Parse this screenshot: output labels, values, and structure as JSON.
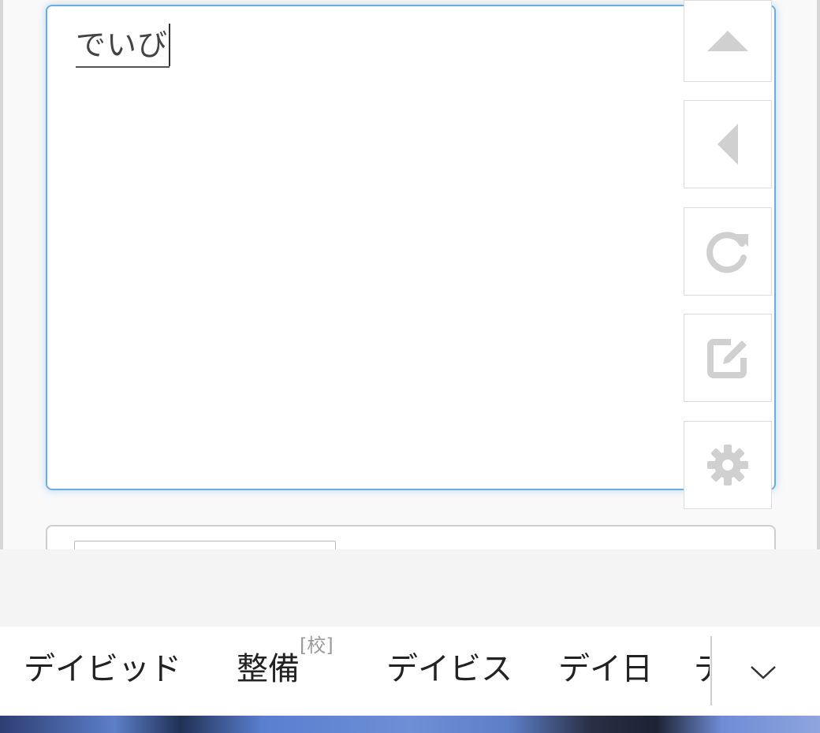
{
  "editor": {
    "composition_text": "でいび"
  },
  "side_toolbar": {
    "buttons": [
      {
        "icon": "triangle-up-icon"
      },
      {
        "icon": "triangle-left-icon"
      },
      {
        "icon": "refresh-icon"
      },
      {
        "icon": "edit-icon"
      },
      {
        "icon": "gear-icon"
      }
    ]
  },
  "candidates": {
    "items": [
      "デイビッド",
      "整備",
      "デイビス",
      "デイ日",
      "デ"
    ],
    "notes": {
      "整備": "[校]"
    }
  },
  "colors": {
    "editor_focus_border": "#68aee6",
    "icon_gray": "#d0d0d0"
  }
}
